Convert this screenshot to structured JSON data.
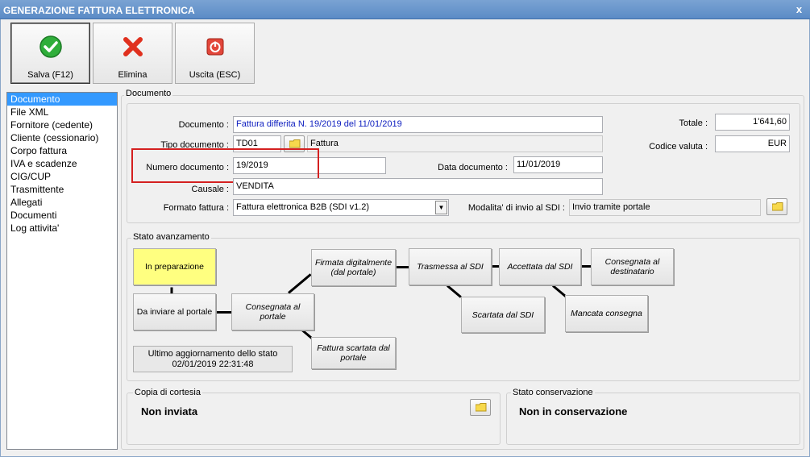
{
  "window": {
    "title": "GENERAZIONE FATTURA ELETTRONICA",
    "close": "x"
  },
  "toolbar": {
    "save_label": "Salva (F12)",
    "delete_label": "Elimina",
    "exit_label": "Uscita (ESC)"
  },
  "nav": {
    "items": [
      {
        "label": "Documento",
        "selected": true
      },
      {
        "label": "File XML"
      },
      {
        "label": "Fornitore (cedente)"
      },
      {
        "label": "Cliente (cessionario)"
      },
      {
        "label": "Corpo fattura"
      },
      {
        "label": "IVA e scadenze"
      },
      {
        "label": "CIG/CUP"
      },
      {
        "label": "Trasmittente"
      },
      {
        "label": "Allegati"
      },
      {
        "label": "Documenti"
      },
      {
        "label": "Log attivita'"
      }
    ]
  },
  "main_group_title": "Documento",
  "documento": {
    "group_title": "Documento",
    "documento_label": "Documento :",
    "documento_value": "Fattura differita N. 19/2019 del 11/01/2019",
    "tipo_label": "Tipo documento :",
    "tipo_code": "TD01",
    "tipo_desc": "Fattura",
    "numero_label": "Numero documento :",
    "numero_value": "19/2019",
    "data_label": "Data documento :",
    "data_value": "11/01/2019",
    "causale_label": "Causale :",
    "causale_value": "VENDITA",
    "formato_label": "Formato fattura :",
    "formato_value": "Fattura elettronica B2B (SDI v1.2)",
    "modalita_label": "Modalita' di invio al SDI :",
    "modalita_value": "Invio tramite portale",
    "totale_label": "Totale :",
    "totale_value": "1'641,60",
    "valuta_label": "Codice valuta :",
    "valuta_value": "EUR"
  },
  "stato": {
    "group_title": "Stato avanzamento",
    "in_preparazione": "In preparazione",
    "da_inviare": "Da inviare al portale",
    "consegnata_portale": "Consegnata al portale",
    "firmata": "Firmata digitalmente (dal portale)",
    "scartata_portale": "Fattura scartata dal portale",
    "trasmessa": "Trasmessa al SDI",
    "scartata_sdi": "Scartata dal SDI",
    "accettata": "Accettata dal SDI",
    "mancata": "Mancata consegna",
    "consegnata_dest": "Consegnata al destinatario",
    "ultimo_label": "Ultimo aggiornamento dello stato",
    "ultimo_value": "02/01/2019 22:31:48"
  },
  "copia": {
    "group_title": "Copia di cortesia",
    "value": "Non inviata"
  },
  "conservazione": {
    "group_title": "Stato conservazione",
    "value": "Non in conservazione"
  },
  "colors": {
    "accent": "#3399ff",
    "current_step": "#ffff80",
    "highlight": "#d42020"
  }
}
